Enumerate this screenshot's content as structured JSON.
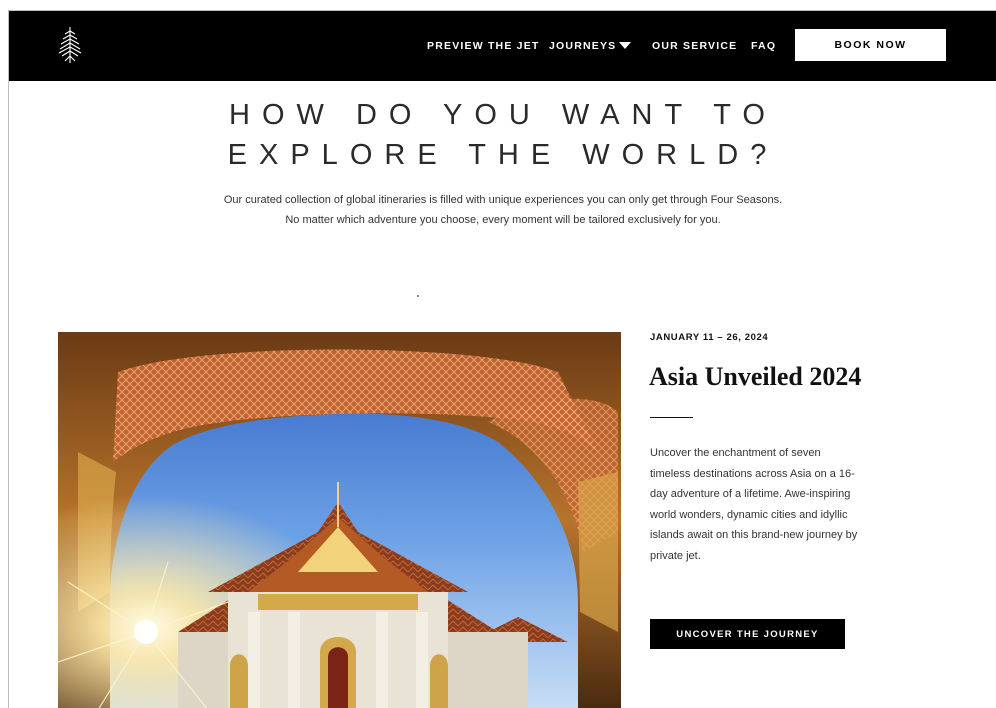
{
  "header": {
    "nav": {
      "preview_jet": "PREVIEW THE JET",
      "journeys": "JOURNEYS",
      "our_service": "OUR SERVICE",
      "faq": "FAQ"
    },
    "book_now": "BOOK NOW",
    "logo_icon": "four-seasons-tree-icon"
  },
  "hero": {
    "headline_line1": "HOW DO YOU WANT TO",
    "headline_line2": "EXPLORE THE WORLD?",
    "intro_line1": "Our curated collection of global itineraries is filled with unique experiences you can only get through Four Seasons.",
    "intro_line2": "No matter which adventure you choose, every moment will be tailored exclusively for you."
  },
  "journey": {
    "date": "JANUARY 11 – 26, 2024",
    "title": "Asia Unveiled 2024",
    "description": "Uncover the enchantment of seven timeless destinations across Asia on a 16-day adventure of a lifetime. Awe-inspiring world wonders, dynamic cities and idyllic islands await on this brand-new journey by private jet.",
    "cta": "UNCOVER THE JOURNEY"
  },
  "colors": {
    "header_bg": "#000000",
    "accent": "#000000",
    "text": "#111111"
  }
}
